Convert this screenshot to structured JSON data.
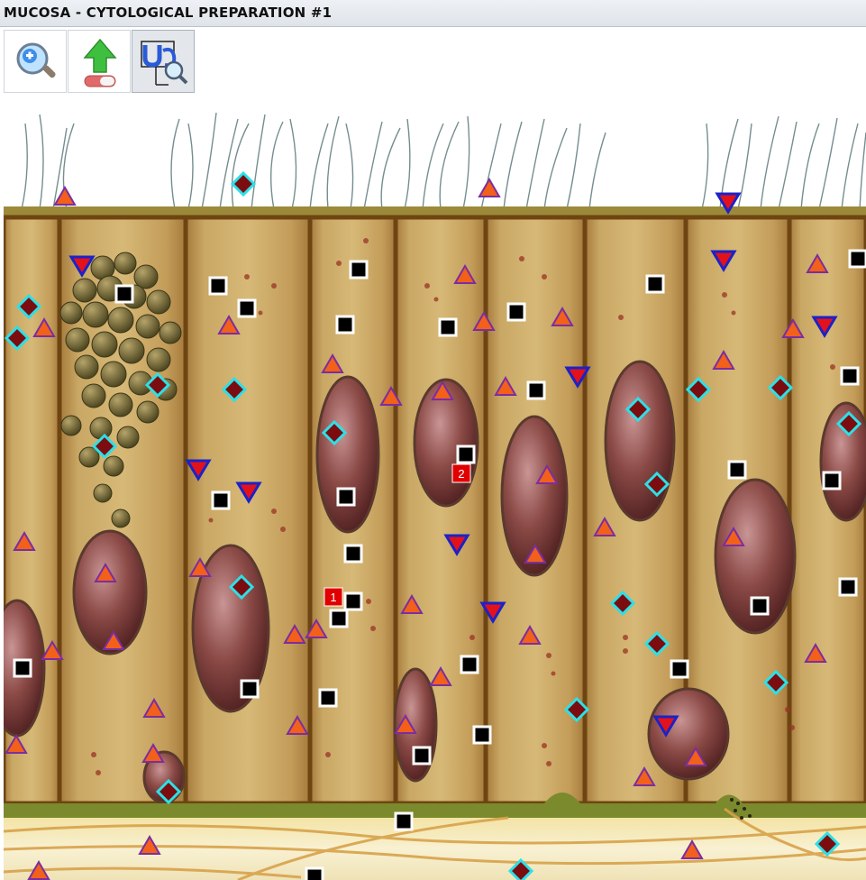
{
  "window": {
    "title": "MUCOSA - CYTOLOGICAL PREPARATION #1"
  },
  "toolbar": {
    "buttons": [
      {
        "name": "zoom-button",
        "icon": "magnifier-plus-icon",
        "active": false
      },
      {
        "name": "upload-button",
        "icon": "green-up-arrow-icon",
        "active": false
      },
      {
        "name": "inspect-tool-button",
        "icon": "inspect-tool-icon",
        "active": true
      }
    ]
  },
  "labels": [
    {
      "text": "1"
    },
    {
      "text": "2"
    }
  ],
  "colors": {
    "cell_fill": "#c7a260",
    "nucleus": "#7a3b37",
    "membrane": "#8a5a1e",
    "marker_square": "#000000",
    "marker_triangle": "#f2601a",
    "marker_triangle_down": "#e3121a",
    "marker_diamond": "#7b0d10",
    "marker_diamond_outline": "#2ce0e8",
    "label_badge": "#e10000"
  }
}
